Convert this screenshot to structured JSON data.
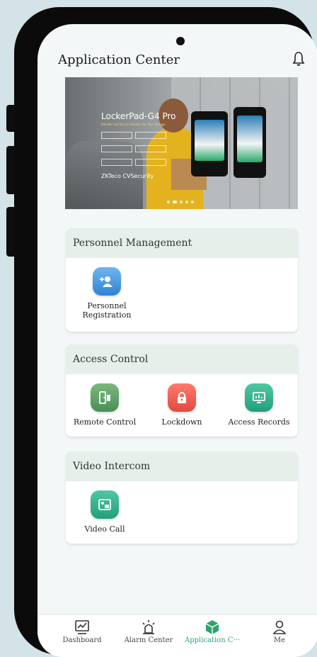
{
  "header": {
    "title": "Application Center",
    "bell_icon": "bell-icon"
  },
  "banner": {
    "product": "LockerPad-G4 Pro",
    "tagline": "Reliable and Secure Solution for Your Storage",
    "brand": "ZKTeco CVSecurity",
    "slide_count": 5,
    "active_slide": 2
  },
  "sections": {
    "personnel": {
      "title": "Personnel Management",
      "items": [
        {
          "label": "Personnel Registration",
          "icon": "add-person-icon",
          "color": "#2f84d6"
        }
      ]
    },
    "access": {
      "title": "Access Control",
      "items": [
        {
          "label": "Remote Control",
          "icon": "remote-door-icon",
          "color": "#4b8f56"
        },
        {
          "label": "Lockdown",
          "icon": "lock-icon",
          "color": "#e14a3e"
        },
        {
          "label": "Access Records",
          "icon": "records-icon",
          "color": "#21a07c"
        }
      ]
    },
    "video": {
      "title": "Video Intercom",
      "items": [
        {
          "label": "Video Call",
          "icon": "video-call-icon",
          "color": "#21a07c"
        }
      ]
    }
  },
  "tabs": [
    {
      "label": "Dashboard",
      "icon": "dashboard-icon",
      "active": false
    },
    {
      "label": "Alarm Center",
      "icon": "alarm-icon",
      "active": false
    },
    {
      "label": "Application C···",
      "icon": "cube-icon",
      "active": true
    },
    {
      "label": "Me",
      "icon": "person-icon",
      "active": false
    }
  ],
  "colors": {
    "accent": "#2fa36b",
    "section_header": "#e6efe9",
    "background": "#f3f7f7"
  }
}
